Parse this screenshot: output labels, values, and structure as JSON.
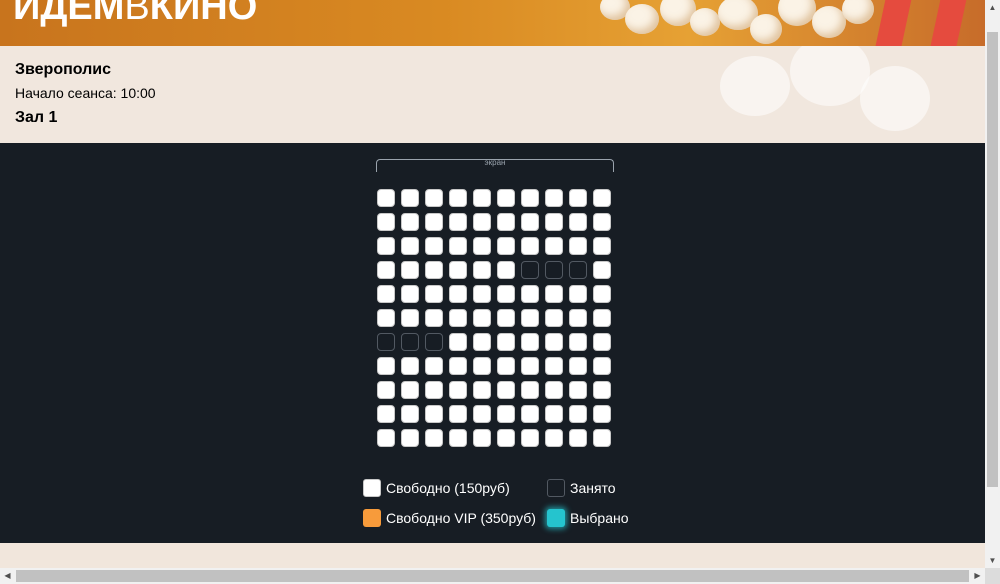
{
  "header": {
    "logo_bold1": "ИДЕМ",
    "logo_thin": "В",
    "logo_bold2": "КИНО"
  },
  "session": {
    "movie_title": "Зверополис",
    "start_time": "Начало сеанса: 10:00",
    "hall": "Зал 1"
  },
  "hall": {
    "screen_label": "экран",
    "rows": [
      [
        "free",
        "free",
        "free",
        "free",
        "free",
        "free",
        "free",
        "free",
        "free",
        "free"
      ],
      [
        "free",
        "free",
        "free",
        "free",
        "free",
        "free",
        "free",
        "free",
        "free",
        "free"
      ],
      [
        "free",
        "free",
        "free",
        "free",
        "free",
        "free",
        "free",
        "free",
        "free",
        "free"
      ],
      [
        "free",
        "free",
        "free",
        "free",
        "free",
        "free",
        "taken",
        "taken",
        "taken",
        "free"
      ],
      [
        "free",
        "free",
        "free",
        "free",
        "free",
        "free",
        "free",
        "free",
        "free",
        "free"
      ],
      [
        "free",
        "free",
        "free",
        "free",
        "free",
        "free",
        "free",
        "free",
        "free",
        "free"
      ],
      [
        "taken",
        "taken",
        "taken",
        "free",
        "free",
        "free",
        "free",
        "free",
        "free",
        "free"
      ],
      [
        "free",
        "free",
        "free",
        "free",
        "free",
        "free",
        "free",
        "free",
        "free",
        "free"
      ],
      [
        "free",
        "free",
        "free",
        "free",
        "free",
        "free",
        "free",
        "free",
        "free",
        "free"
      ],
      [
        "free",
        "free",
        "free",
        "free",
        "free",
        "free",
        "free",
        "free",
        "free",
        "free"
      ],
      [
        "free",
        "free",
        "free",
        "free",
        "free",
        "free",
        "free",
        "free",
        "free",
        "free"
      ]
    ]
  },
  "legend": {
    "free": "Свободно (150руб)",
    "taken": "Занято",
    "vip": "Свободно VIP (350руб)",
    "selected": "Выбрано"
  },
  "colors": {
    "free": "#ffffff",
    "taken": "#171d24",
    "vip": "#f79b3b",
    "selected": "#25c4ce",
    "hall_bg": "#171d24"
  },
  "scrollbars": {
    "up_icon": "arrow-up-icon",
    "down_icon": "arrow-down-icon",
    "left_icon": "arrow-left-icon",
    "right_icon": "arrow-right-icon"
  }
}
